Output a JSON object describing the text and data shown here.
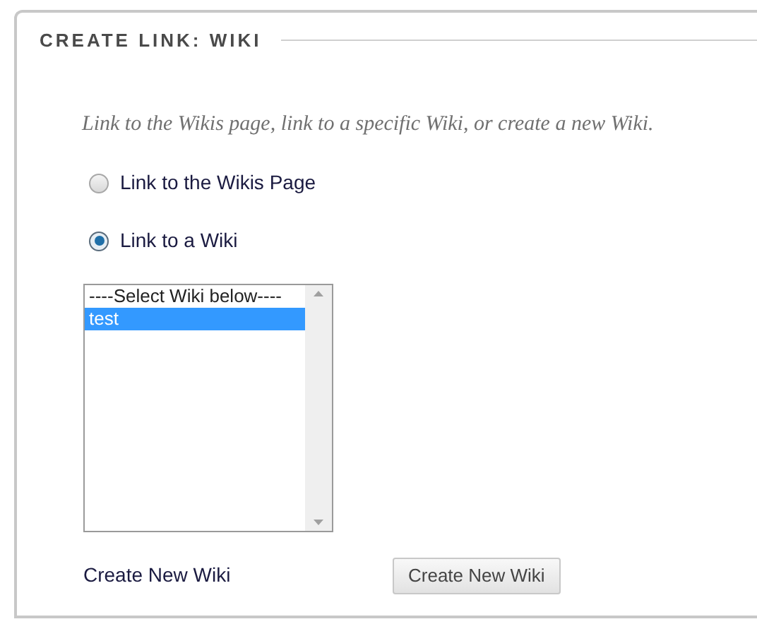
{
  "panel": {
    "title": "CREATE LINK: WIKI"
  },
  "description": "Link to the Wikis page, link to a specific Wiki, or create a new Wiki.",
  "options": [
    {
      "label": "Link to the Wikis Page",
      "selected": false
    },
    {
      "label": "Link to a Wiki",
      "selected": true
    }
  ],
  "wiki_list": {
    "items": [
      {
        "label": "----Select Wiki below----",
        "selected": false
      },
      {
        "label": "test",
        "selected": true
      }
    ]
  },
  "create": {
    "label": "Create New Wiki",
    "button": "Create New Wiki"
  }
}
